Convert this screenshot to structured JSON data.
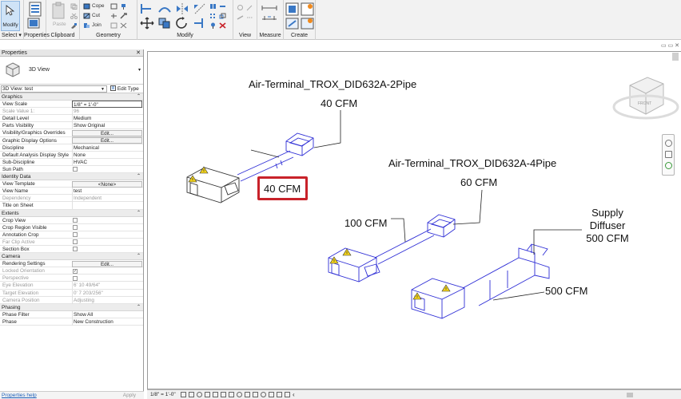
{
  "ribbon": {
    "modify_label": "Modify",
    "select_label": "Select",
    "select_arrow": "▾",
    "properties_label": "Properties",
    "clipboard": {
      "label": "Clipboard",
      "paste": "Paste"
    },
    "geometry": {
      "label": "Geometry",
      "cope": "Cope",
      "cut": "Cut",
      "join": "Join"
    },
    "modify": {
      "label": "Modify"
    },
    "view": {
      "label": "View"
    },
    "measure": {
      "label": "Measure"
    },
    "create": {
      "label": "Create"
    }
  },
  "properties": {
    "title": "Properties",
    "close": "✕",
    "type_name": "3D View",
    "type_dropdown": "▾",
    "filter": "3D View: test",
    "edit_type": "Edit Type",
    "sections": [
      {
        "name": "Graphics",
        "rows": [
          {
            "k": "View Scale",
            "v": "1/8\" = 1'-0\"",
            "boxed": true
          },
          {
            "k": "Scale Value    1:",
            "v": "96",
            "dim": true
          },
          {
            "k": "Detail Level",
            "v": "Medium"
          },
          {
            "k": "Parts Visibility",
            "v": "Show Original"
          },
          {
            "k": "Visibility/Graphics Overrides",
            "btn": "Edit..."
          },
          {
            "k": "Graphic Display Options",
            "btn": "Edit..."
          },
          {
            "k": "Discipline",
            "v": "Mechanical"
          },
          {
            "k": "Default Analysis Display Style",
            "v": "None"
          },
          {
            "k": "Sub-Discipline",
            "v": "HVAC"
          },
          {
            "k": "Sun Path",
            "cb": ""
          }
        ]
      },
      {
        "name": "Identity Data",
        "rows": [
          {
            "k": "View Template",
            "btn": "<None>"
          },
          {
            "k": "View Name",
            "v": "test"
          },
          {
            "k": "Dependency",
            "v": "Independent",
            "dim": true
          },
          {
            "k": "Title on Sheet",
            "v": ""
          }
        ]
      },
      {
        "name": "Extents",
        "rows": [
          {
            "k": "Crop View",
            "cb": ""
          },
          {
            "k": "Crop Region Visible",
            "cb": ""
          },
          {
            "k": "Annotation Crop",
            "cb": ""
          },
          {
            "k": "Far Clip Active",
            "cb": "",
            "dim": true
          },
          {
            "k": "Section Box",
            "cb": ""
          }
        ]
      },
      {
        "name": "Camera",
        "rows": [
          {
            "k": "Rendering Settings",
            "btn": "Edit..."
          },
          {
            "k": "Locked Orientation",
            "cb": "✓",
            "dim": true
          },
          {
            "k": "Perspective",
            "cb": "",
            "dim": true
          },
          {
            "k": "Eye Elevation",
            "v": "6'  10 49/64\"",
            "dim": true
          },
          {
            "k": "Target Elevation",
            "v": "0'  7 203/256\"",
            "dim": true
          },
          {
            "k": "Camera Position",
            "v": "Adjusting",
            "dim": true
          }
        ]
      },
      {
        "name": "Phasing",
        "rows": [
          {
            "k": "Phase Filter",
            "v": "Show All"
          },
          {
            "k": "Phase",
            "v": "New Construction"
          }
        ]
      }
    ],
    "section_toggle": "⌃",
    "help": "Properties help",
    "apply": "Apply"
  },
  "view": {
    "window_controls": "▭ ▭ ✕",
    "scale": "1/8\" = 1'-0\"",
    "scroll_left": "‹",
    "viewcube_face": "FRONT",
    "annotations": {
      "terminal_2pipe": "Air-Terminal_TROX_DID632A-2Pipe",
      "cfm_2pipe": "40 CFM",
      "cfm_highlight": "40 CFM",
      "terminal_4pipe": "Air-Terminal_TROX_DID632A-4Pipe",
      "cfm_4pipe": "60 CFM",
      "cfm_100": "100 CFM",
      "supply_1": "Supply",
      "supply_2": "Diffuser",
      "supply_cfm": "500 CFM",
      "cfm_500": "500 CFM"
    }
  },
  "colors": {
    "duct": "#2f2fd6",
    "highlight": "#c8222a",
    "warning": "#f2d21a"
  }
}
